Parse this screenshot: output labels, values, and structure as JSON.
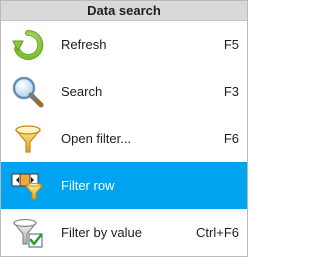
{
  "menu": {
    "title": "Data search",
    "items": [
      {
        "label": "Refresh",
        "shortcut": "F5",
        "icon": "refresh-icon",
        "selected": false
      },
      {
        "label": "Search",
        "shortcut": "F3",
        "icon": "magnifier-icon",
        "selected": false
      },
      {
        "label": "Open filter...",
        "shortcut": "F6",
        "icon": "funnel-icon",
        "selected": false
      },
      {
        "label": "Filter row",
        "shortcut": "",
        "icon": "filter-row-icon",
        "selected": true
      },
      {
        "label": "Filter by value",
        "shortcut": "Ctrl+F6",
        "icon": "filter-by-value-icon",
        "selected": false
      }
    ]
  },
  "colors": {
    "selection": "#00a3ef",
    "header_bg": "#d9d9d9"
  }
}
